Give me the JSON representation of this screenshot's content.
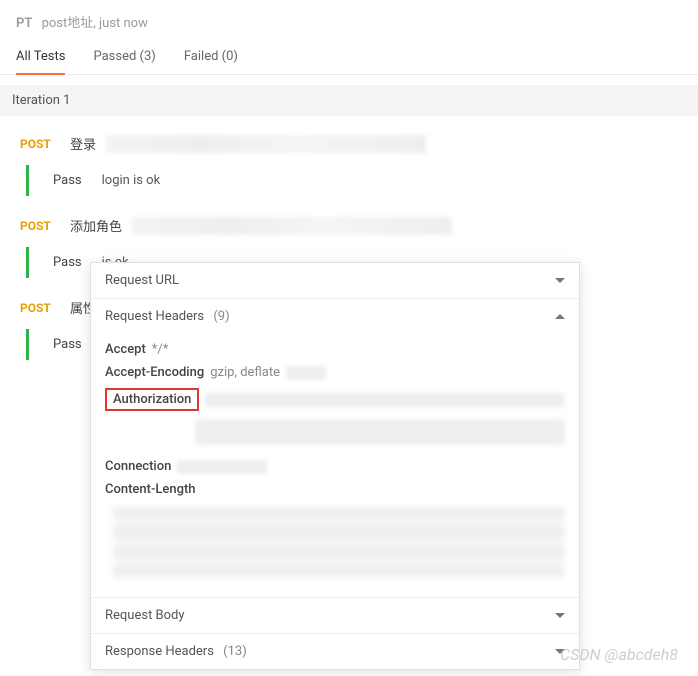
{
  "header": {
    "prefix": "PT",
    "subtitle": "post地址, just now"
  },
  "tabs": {
    "all": "All Tests",
    "passed": "Passed (3)",
    "failed": "Failed (0)"
  },
  "iteration_label": "Iteration 1",
  "requests": [
    {
      "method": "POST",
      "name": "登录",
      "pass_label": "Pass",
      "test_msg": "login is ok"
    },
    {
      "method": "POST",
      "name": "添加角色",
      "pass_label": "Pass",
      "test_msg": "is ok"
    },
    {
      "method": "POST",
      "name": "属性",
      "pass_label": "Pass",
      "test_msg": ""
    }
  ],
  "panel": {
    "request_url": {
      "title": "Request URL"
    },
    "request_headers": {
      "title": "Request Headers",
      "count": "(9)",
      "items": {
        "accept": {
          "key": "Accept",
          "val": "*/*"
        },
        "accept_encoding": {
          "key": "Accept-Encoding",
          "val": "gzip, deflate"
        },
        "authorization": {
          "key": "Authorization"
        },
        "connection": {
          "key": "Connection"
        },
        "content_length": {
          "key": "Content-Length"
        }
      }
    },
    "request_body": {
      "title": "Request Body"
    },
    "response_headers": {
      "title": "Response Headers",
      "count": "(13)"
    }
  },
  "watermark": "CSDN @abcdeh8"
}
